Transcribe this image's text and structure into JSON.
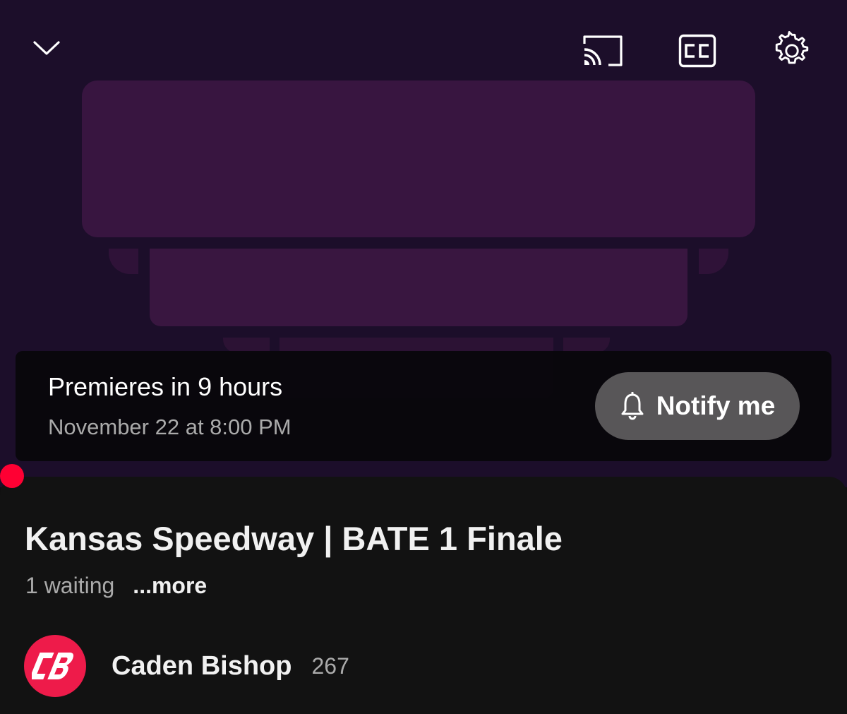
{
  "player": {
    "icons": {
      "collapse": "chevron-down-icon",
      "cast": "cast-icon",
      "captions": "closed-captions-icon",
      "settings": "gear-icon"
    },
    "premiere": {
      "title": "Premieres in 9 hours",
      "datetime": "November 22 at 8:00 PM",
      "notify_label": "Notify me",
      "notify_icon": "bell-icon"
    }
  },
  "video": {
    "title": "Kansas Speedway | BATE 1 Finale",
    "waiting": "1 waiting",
    "more_label": "...more"
  },
  "channel": {
    "name": "Caden Bishop",
    "subscribers": "267",
    "avatar_text": "CB"
  },
  "colors": {
    "player_bg": "#1c0e2a",
    "thumbnail_shape": "#381540",
    "accent_red": "#ff0033",
    "avatar_bg": "#ee1b4a",
    "surface": "#121212",
    "secondary_text": "#aaaaaa"
  }
}
